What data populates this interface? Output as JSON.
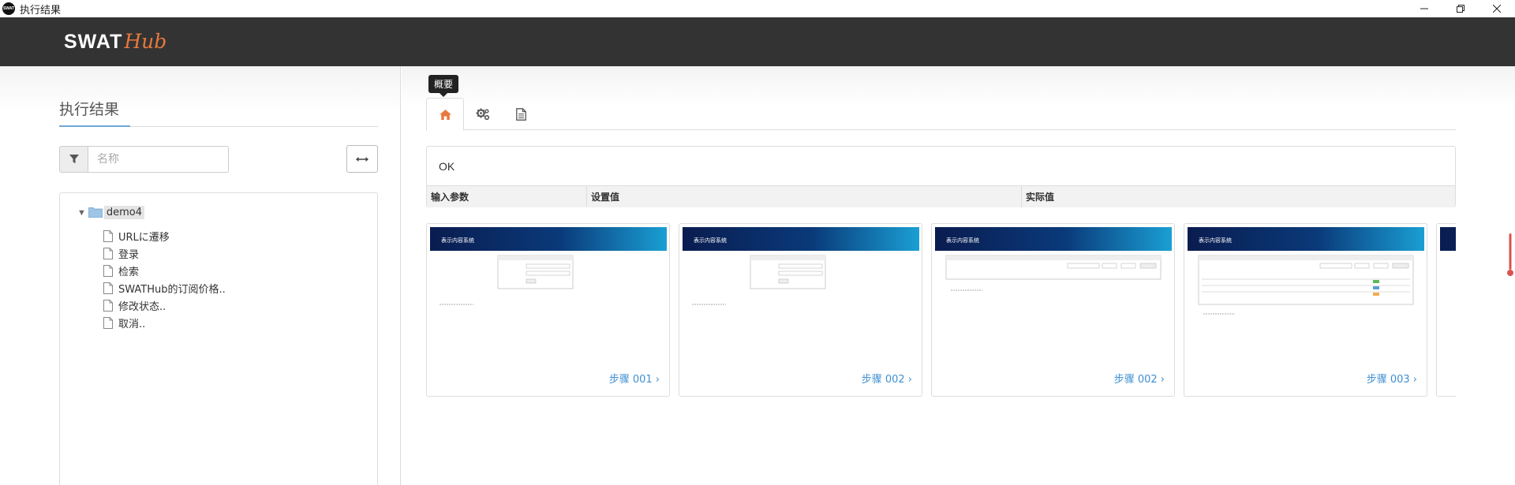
{
  "window": {
    "title": "执行结果",
    "app_icon_text": "SWAT"
  },
  "header": {
    "logo_main": "SWAT",
    "logo_accent": "Hub"
  },
  "left": {
    "title": "执行结果",
    "filter_placeholder": "名称",
    "tree": {
      "root": "demo4",
      "children": [
        "URLに遷移",
        "登录",
        "检索",
        "SWATHub的订阅价格..",
        "修改状态..",
        "取消.."
      ]
    }
  },
  "right": {
    "tooltip": "概要",
    "summary_status": "OK",
    "param_columns": [
      "输入参数",
      "设置值",
      "实际值"
    ],
    "thumbnail_banner": "表示内容系统",
    "steps": [
      "步骤 001 ›",
      "步骤 002 ›",
      "步骤 002 ›",
      "步骤 003 ›"
    ]
  },
  "colors": {
    "accent": "#e8793d",
    "link": "#3f8fd2",
    "header_bg": "#333333"
  }
}
